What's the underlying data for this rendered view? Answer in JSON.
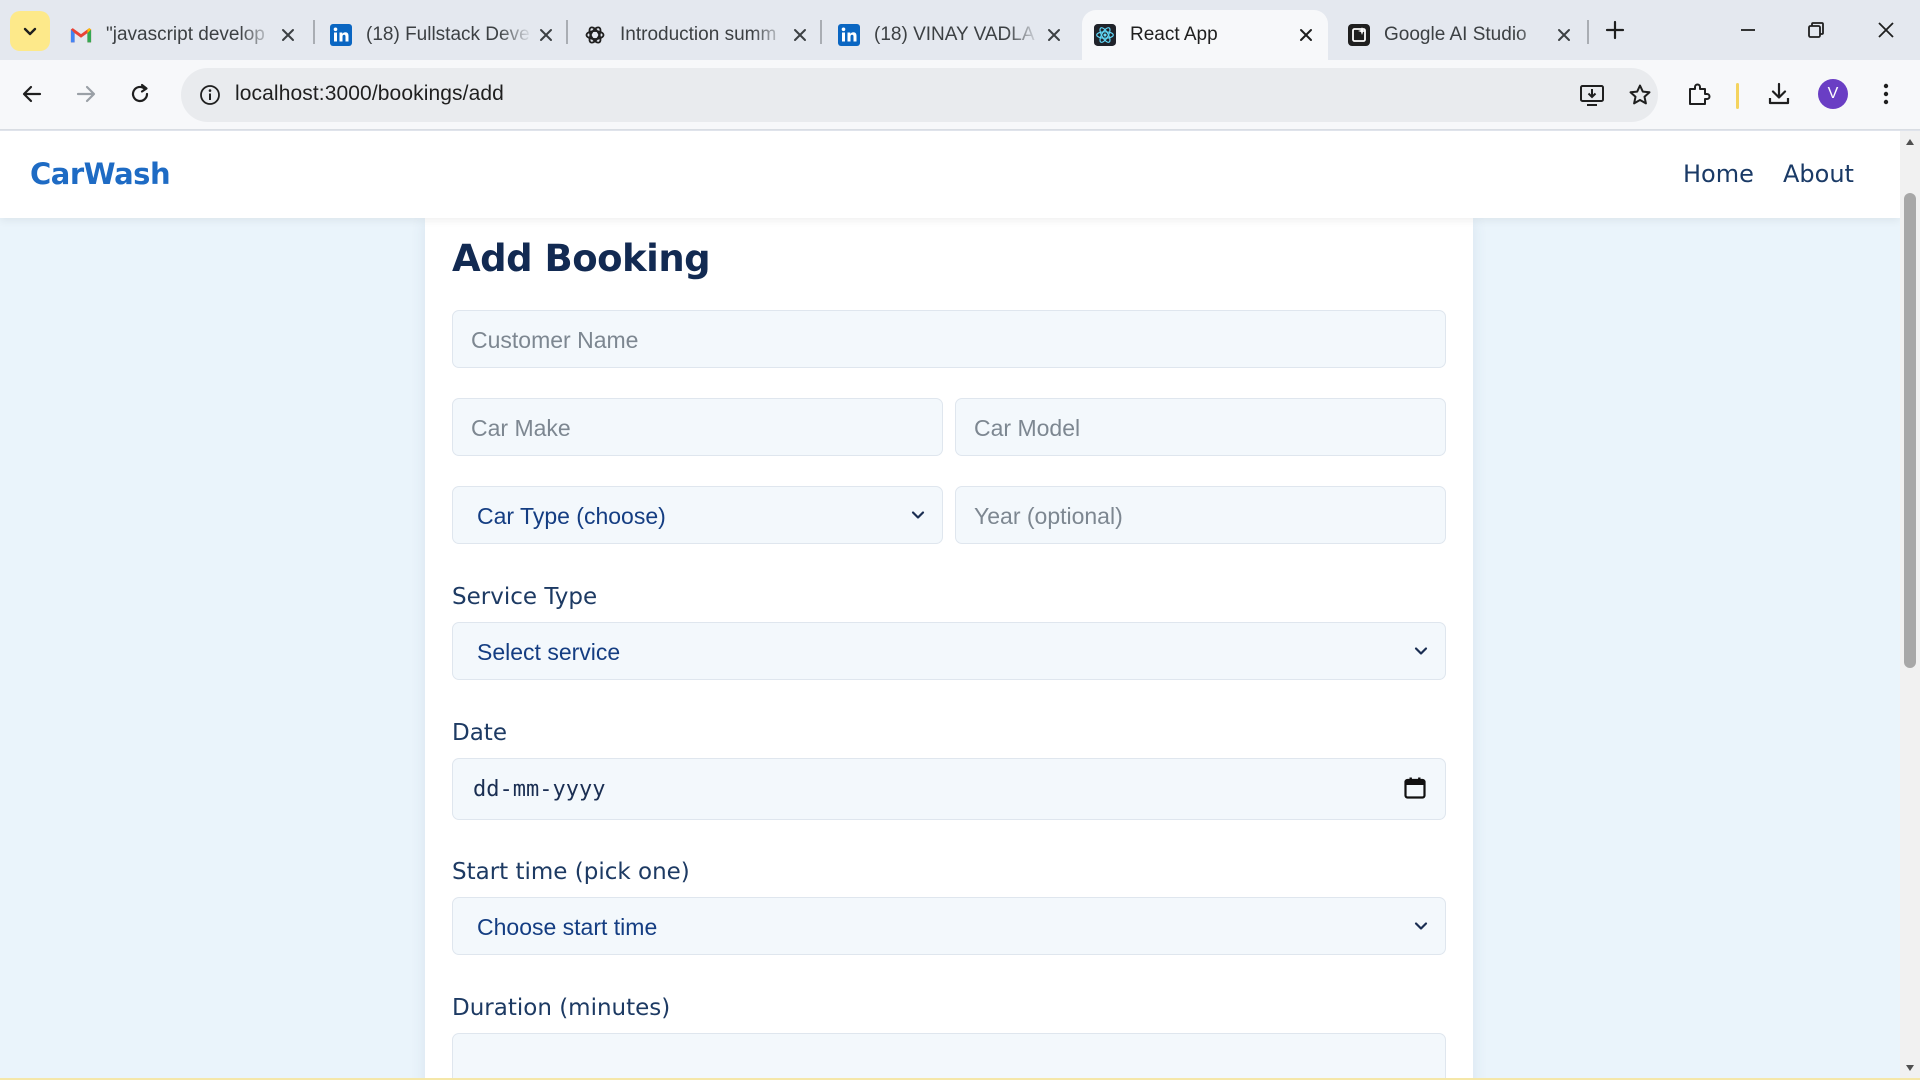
{
  "browser": {
    "tabs": [
      {
        "title": "\"javascript develop",
        "icon": "gmail-icon"
      },
      {
        "title": "(18) Fullstack Deve",
        "icon": "linkedin-icon"
      },
      {
        "title": "Introduction summ",
        "icon": "openai-icon"
      },
      {
        "title": "(18) VINAY VADLA",
        "icon": "linkedin-icon"
      },
      {
        "title": "React App",
        "icon": "react-icon",
        "active": true
      },
      {
        "title": "Google AI Studio",
        "icon": "ai-studio-icon"
      }
    ],
    "url": "localhost:3000/bookings/add",
    "profile_initial": "V"
  },
  "app": {
    "brand": "CarWash",
    "nav": {
      "home": "Home",
      "about": "About"
    }
  },
  "form": {
    "heading": "Add Booking",
    "customer_name_placeholder": "Customer Name",
    "car_make_placeholder": "Car Make",
    "car_model_placeholder": "Car Model",
    "car_type_selected": "Car Type (choose)",
    "year_placeholder": "Year (optional)",
    "service_type_label": "Service Type",
    "service_selected": "Select service",
    "date_label": "Date",
    "date_placeholder": "dd-mm-yyyy",
    "start_time_label": "Start time (pick one)",
    "start_time_selected": "Choose start time",
    "duration_label": "Duration (minutes)",
    "duration_value": ""
  },
  "colors": {
    "brand": "#1e6bc4",
    "page_background": "#eaf4fb",
    "heading": "#122a52",
    "select_text": "#143d82"
  }
}
